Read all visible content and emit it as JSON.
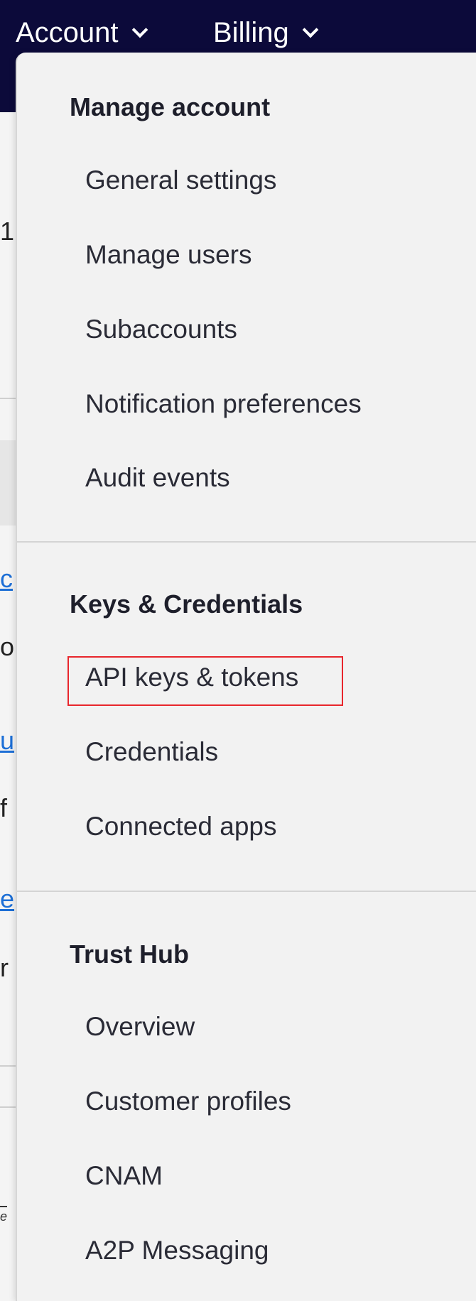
{
  "topnav": {
    "items": [
      {
        "label": "Account"
      },
      {
        "label": "Billing"
      }
    ]
  },
  "background": {
    "fragments": [
      "1",
      "c",
      "o",
      "u",
      "f",
      "e",
      "r",
      "e"
    ]
  },
  "menu": {
    "sections": [
      {
        "title": "Manage account",
        "items": [
          {
            "label": "General settings"
          },
          {
            "label": "Manage users"
          },
          {
            "label": "Subaccounts"
          },
          {
            "label": "Notification preferences"
          },
          {
            "label": "Audit events"
          }
        ]
      },
      {
        "title": "Keys & Credentials",
        "items": [
          {
            "label": "API keys & tokens"
          },
          {
            "label": "Credentials"
          },
          {
            "label": "Connected apps"
          }
        ]
      },
      {
        "title": "Trust Hub",
        "items": [
          {
            "label": "Overview"
          },
          {
            "label": "Customer profiles"
          },
          {
            "label": "CNAM"
          },
          {
            "label": "A2P Messaging"
          }
        ]
      }
    ]
  },
  "colors": {
    "topbar": "#0c0a3a",
    "menu_bg": "#f2f2f2",
    "highlight": "#e8262c",
    "link": "#1d6fd6"
  }
}
